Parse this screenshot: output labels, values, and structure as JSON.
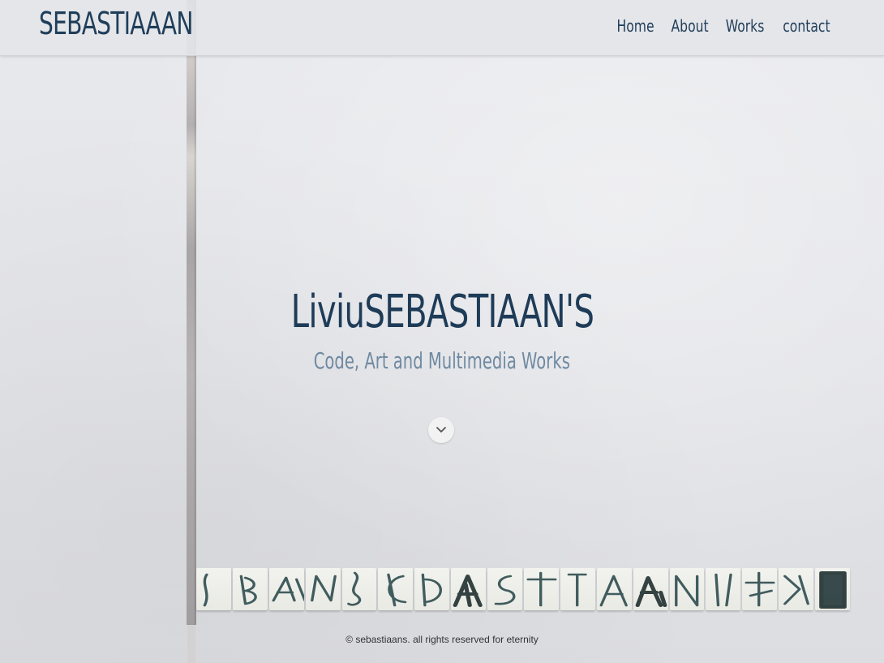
{
  "header": {
    "logo": "SEBASTIAAAN",
    "nav": [
      "Home",
      "About",
      "Works",
      "contact"
    ]
  },
  "hero": {
    "title": "LiviuSEBASTIAAN'S",
    "subtitle": "Code, Art and Multimedia Works",
    "scroll_icon": "chevron-down-icon"
  },
  "footer": {
    "copyright": "© sebastiaans. all rights reserved for eternity"
  },
  "colors": {
    "primary": "#1f3e5a",
    "subtitle": "#6f8aa2",
    "background": "#e6e7eb"
  }
}
